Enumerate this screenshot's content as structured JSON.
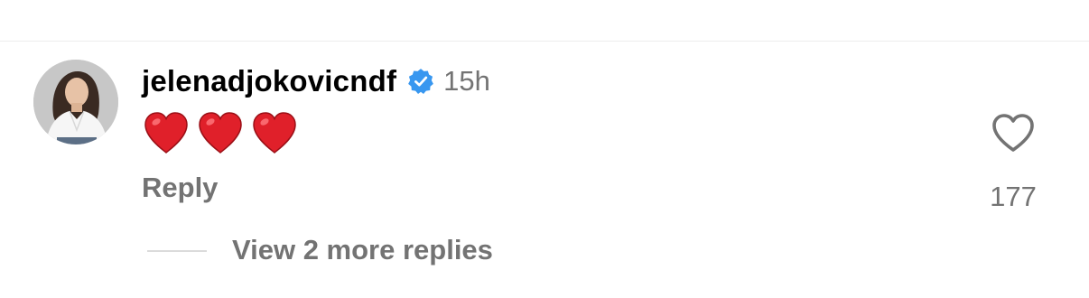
{
  "comment": {
    "username": "jelenadjokovicndf",
    "verified": true,
    "verified_icon": "verified-badge-icon",
    "timestamp": "15h",
    "emoji": [
      "❤️",
      "❤️",
      "❤️"
    ],
    "reply_label": "Reply",
    "like_icon": "heart-outline-icon",
    "like_count": "177",
    "view_replies_label": "View 2 more replies"
  },
  "colors": {
    "verified_blue": "#3897f0",
    "secondary_text": "#737373",
    "heart_red": "#e0202a"
  }
}
